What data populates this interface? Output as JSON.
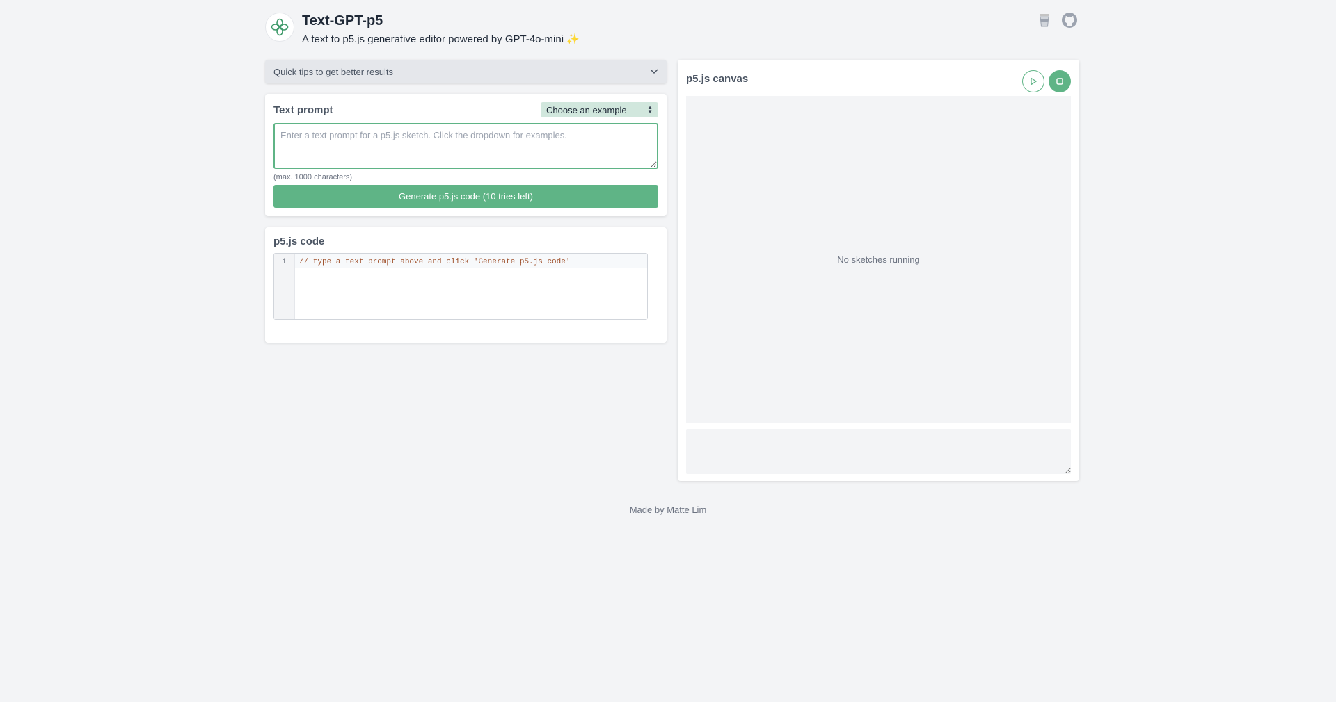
{
  "header": {
    "title": "Text-GPT-p5",
    "subtitle": "A text to p5.js generative editor powered by GPT-4o-mini",
    "subtitle_emoji": "✨",
    "icons": [
      "coffee-cup-icon",
      "github-icon"
    ]
  },
  "tips": {
    "label": "Quick tips to get better results"
  },
  "prompt": {
    "title": "Text prompt",
    "example_select": "Choose an example",
    "placeholder": "Enter a text prompt for a p5.js sketch. Click the dropdown for examples.",
    "hint": "(max. 1000 characters)",
    "generate_label": "Generate p5.js code (10 tries left)"
  },
  "code": {
    "title": "p5.js code",
    "line_number": "1",
    "line_text": "// type a text prompt above and click 'Generate p5.js code'"
  },
  "canvas": {
    "title": "p5.js canvas",
    "status": "No sketches running"
  },
  "footer": {
    "prefix": "Made by ",
    "author": "Matte Lim"
  },
  "colors": {
    "accent": "#5fb486",
    "background": "#f3f4f6"
  }
}
